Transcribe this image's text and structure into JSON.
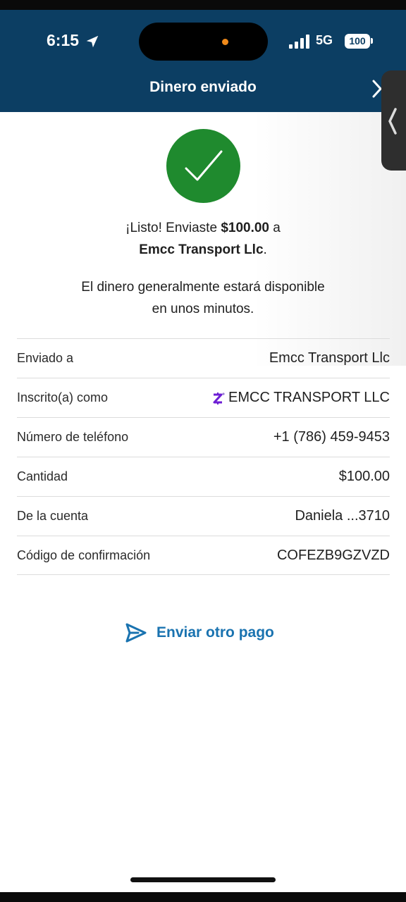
{
  "status_bar": {
    "time": "6:15",
    "network": "5G",
    "battery": "100"
  },
  "header": {
    "title": "Dinero enviado"
  },
  "confirmation": {
    "line1_prefix": "¡Listo! Enviaste ",
    "amount": "$100.00",
    "line1_suffix": " a",
    "recipient": "Emcc Transport Llc",
    "recipient_suffix": ".",
    "availability_line1": "El dinero generalmente estará disponible",
    "availability_line2": "en unos minutos."
  },
  "details": [
    {
      "label": "Enviado a",
      "value": "Emcc Transport Llc"
    },
    {
      "label": "Inscrito(a) como",
      "value": "EMCC TRANSPORT LLC",
      "icon": "zelle-icon"
    },
    {
      "label": "Número de teléfono",
      "value": "+1 (786) 459-9453"
    },
    {
      "label": "Cantidad",
      "value": "$100.00"
    },
    {
      "label": "De la cuenta",
      "value": "Daniela ...3710"
    },
    {
      "label": "Código de confirmación",
      "value": "COFEZB9GZVZD"
    }
  ],
  "actions": {
    "send_another": "Enviar otro pago"
  },
  "colors": {
    "header_bg": "#0c3e63",
    "success_green": "#1f8a2e",
    "link_blue": "#1a73b0",
    "zelle_purple": "#6d1ed4"
  }
}
